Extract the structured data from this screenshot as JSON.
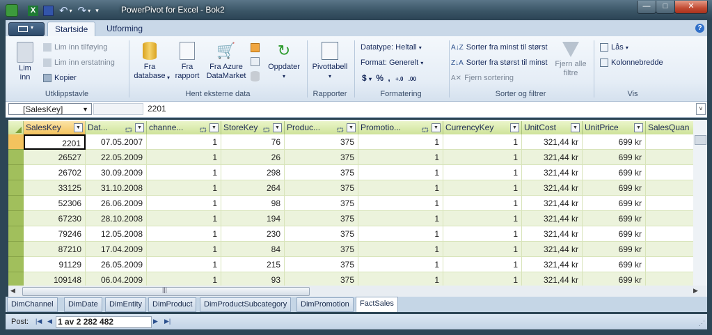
{
  "window": {
    "title": "PowerPivot for Excel - Bok2",
    "min": "—",
    "max": "□",
    "close": "✕"
  },
  "ribbon": {
    "tabs": [
      "Startside",
      "Utforming"
    ],
    "clipboard": {
      "paste": "Lim\ninn",
      "paste_append": "Lim inn tilføying",
      "paste_replace": "Lim inn erstatning",
      "copy": "Kopier",
      "label": "Utklippstavle"
    },
    "external": {
      "from_db": "Fra\ndatabase",
      "from_report": "Fra\nrapport",
      "from_azure": "Fra Azure\nDataMarket",
      "refresh": "Oppdater",
      "label": "Hent eksterne data"
    },
    "reports": {
      "pivot": "Pivottabell",
      "label": "Rapporter"
    },
    "formatting": {
      "datatype": "Datatype: Heltall",
      "format": "Format: Generelt",
      "label": "Formatering"
    },
    "sort": {
      "asc": "Sorter fra minst til størst",
      "desc": "Sorter fra størst til minst",
      "clear": "Fjern sortering",
      "clear_filters": "Fjern alle\nfiltre",
      "label": "Sorter og filtrer"
    },
    "view": {
      "freeze": "Lås",
      "col_width": "Kolonnebredde",
      "label": "Vis"
    }
  },
  "formula_bar": {
    "name_box": "[SalesKey]",
    "value": "2201"
  },
  "grid": {
    "columns": [
      "SalesKey",
      "Dat...",
      "channe...",
      "StoreKey",
      "Produc...",
      "Promotio...",
      "CurrencyKey",
      "UnitCost",
      "UnitPrice",
      "SalesQuan"
    ],
    "rows": [
      [
        "2201",
        "07.05.2007",
        "1",
        "76",
        "375",
        "1",
        "1",
        "321,44 kr",
        "699 kr"
      ],
      [
        "26527",
        "22.05.2009",
        "1",
        "26",
        "375",
        "1",
        "1",
        "321,44 kr",
        "699 kr"
      ],
      [
        "26702",
        "30.09.2009",
        "1",
        "298",
        "375",
        "1",
        "1",
        "321,44 kr",
        "699 kr"
      ],
      [
        "33125",
        "31.10.2008",
        "1",
        "264",
        "375",
        "1",
        "1",
        "321,44 kr",
        "699 kr"
      ],
      [
        "52306",
        "26.06.2009",
        "1",
        "98",
        "375",
        "1",
        "1",
        "321,44 kr",
        "699 kr"
      ],
      [
        "67230",
        "28.10.2008",
        "1",
        "194",
        "375",
        "1",
        "1",
        "321,44 kr",
        "699 kr"
      ],
      [
        "79246",
        "12.05.2008",
        "1",
        "230",
        "375",
        "1",
        "1",
        "321,44 kr",
        "699 kr"
      ],
      [
        "87210",
        "17.04.2009",
        "1",
        "84",
        "375",
        "1",
        "1",
        "321,44 kr",
        "699 kr"
      ],
      [
        "91129",
        "26.05.2009",
        "1",
        "215",
        "375",
        "1",
        "1",
        "321,44 kr",
        "699 kr"
      ],
      [
        "109148",
        "06.04.2009",
        "1",
        "93",
        "375",
        "1",
        "1",
        "321,44 kr",
        "699 kr"
      ]
    ]
  },
  "sheet_tabs": [
    "DimChannel",
    "DimDate",
    "DimEntity",
    "DimProduct",
    "DimProductSubcategory",
    "DimPromotion",
    "FactSales"
  ],
  "status": {
    "label": "Post:",
    "record": "1 av 2 282 482"
  }
}
